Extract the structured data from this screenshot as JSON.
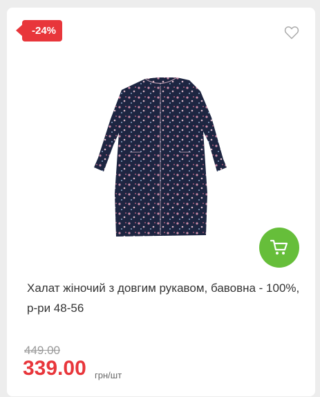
{
  "product": {
    "discount_badge": "-24%",
    "title": "Халат жіночий з довгим рукавом, бавовна - 100%, р-ри 48-56",
    "old_price": "449.00",
    "price": "339.00",
    "unit": "грн/шт"
  },
  "icons": {
    "favorite": "heart-outline-icon",
    "cart": "shopping-cart-icon"
  },
  "colors": {
    "badge": "#e8363b",
    "price": "#e8363b",
    "cart_button": "#66be3a",
    "dress": "#1d2541"
  }
}
